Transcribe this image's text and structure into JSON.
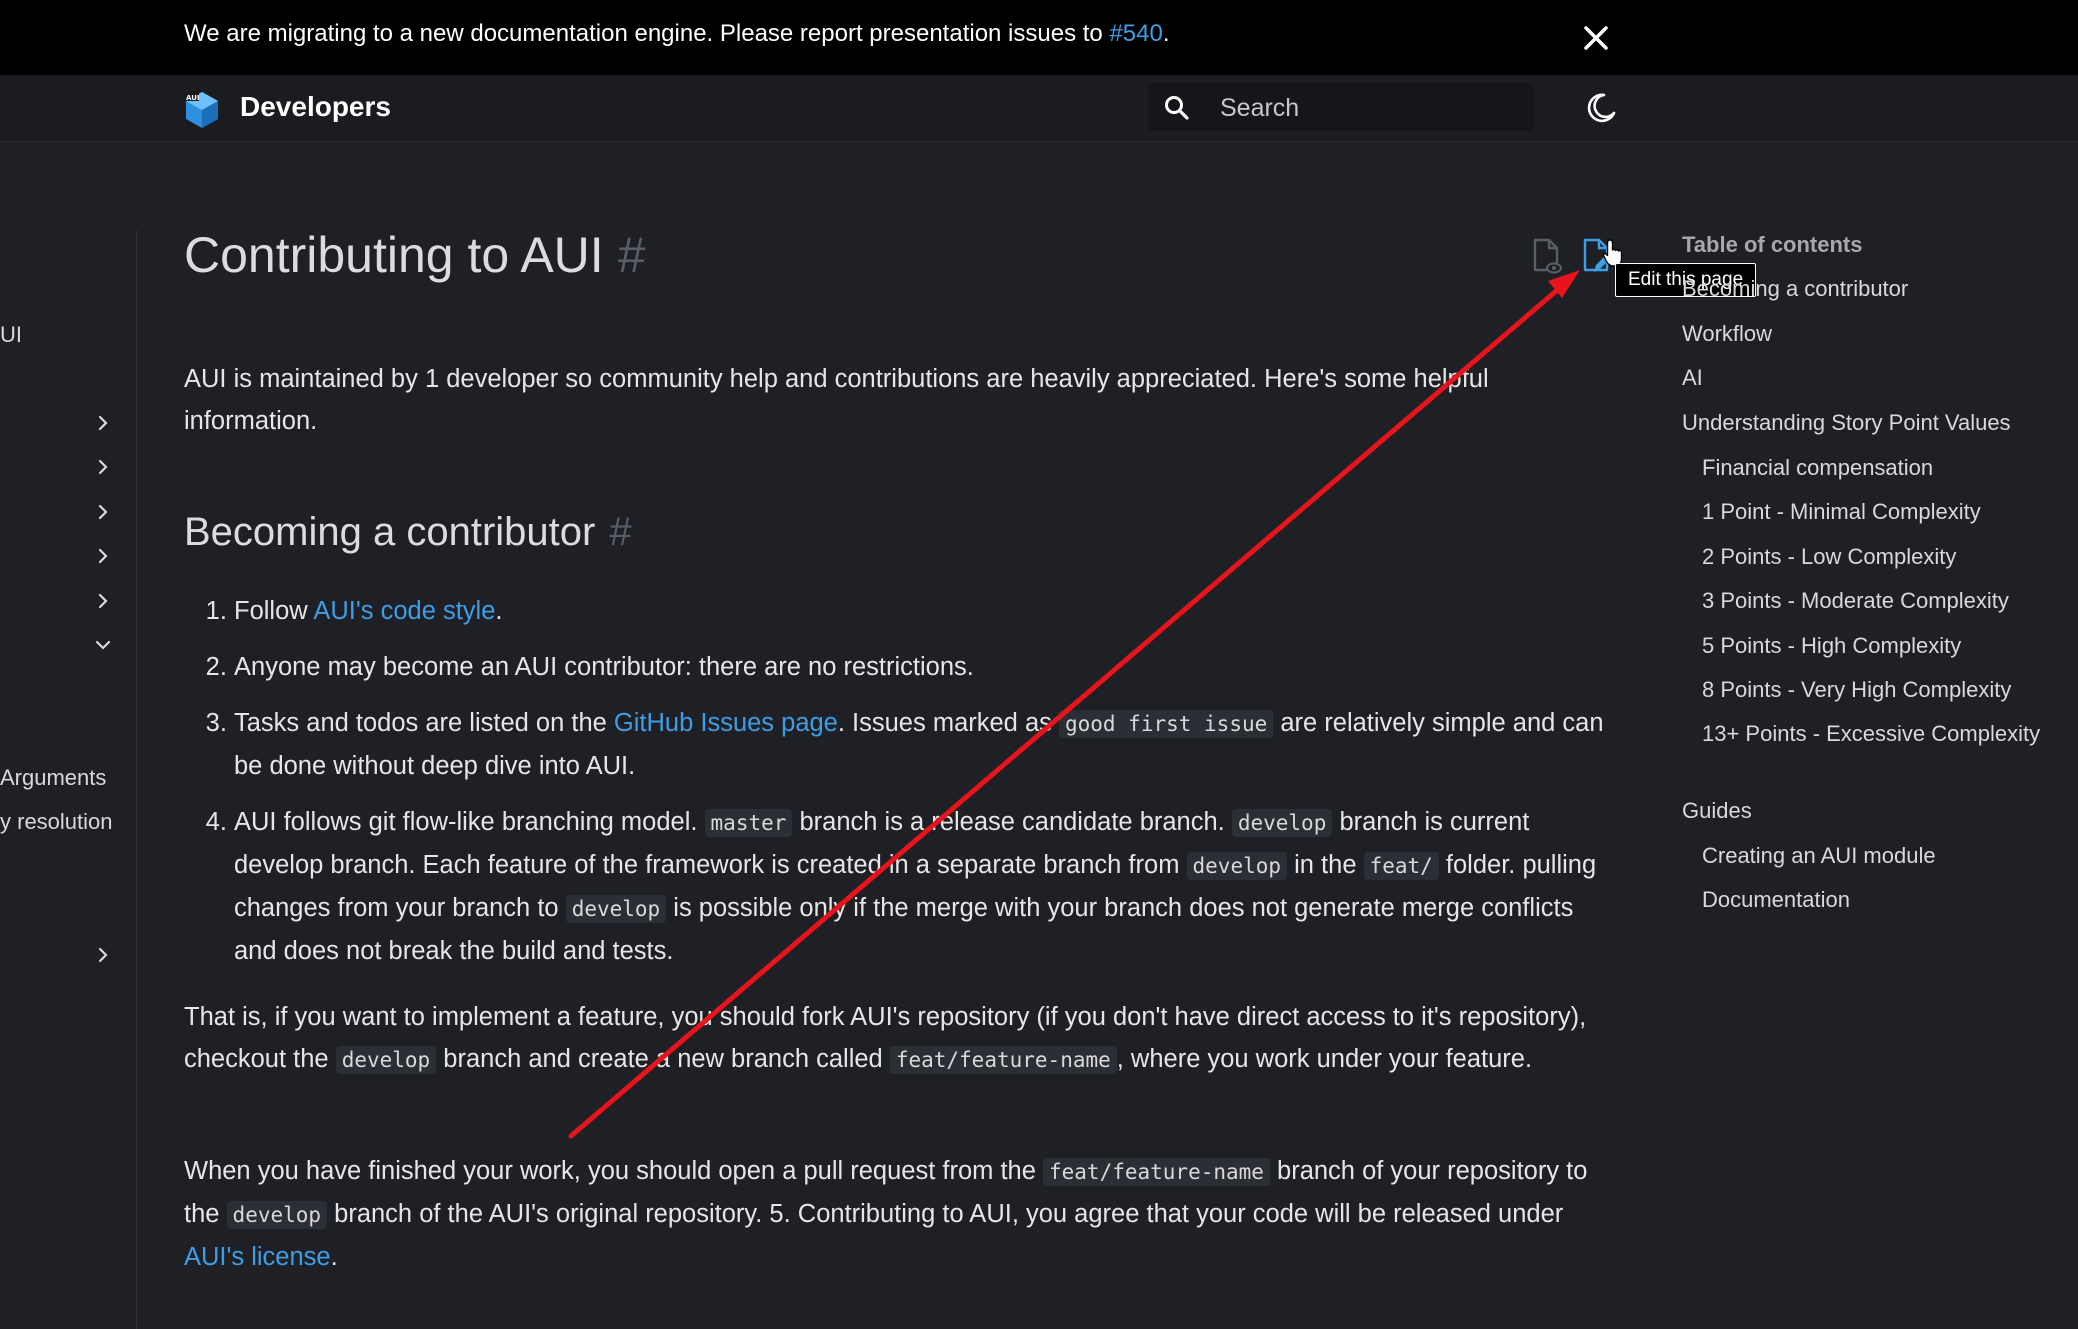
{
  "banner": {
    "text": "We are migrating to a new documentation engine. Please report presentation issues to ",
    "link": "#540",
    "text_end": "."
  },
  "header": {
    "brand": "Developers",
    "search_placeholder": "Search"
  },
  "sidebar": {
    "fragments": [
      "UI",
      "Arguments",
      "y resolution"
    ]
  },
  "main": {
    "title": "Contributing to AUI",
    "hash": "#",
    "tooltip": "Edit this page",
    "intro": "AUI is maintained by 1 developer so community help and contributions are heavily appreciated. Here's some helpful information.",
    "section_title": "Becoming a contributor",
    "steps": {
      "s1_pre": "Follow ",
      "s1_link": "AUI's code style",
      "s1_post": ".",
      "s2": "Anyone may become an AUI contributor: there are no restrictions.",
      "s3_pre": "Tasks and todos are listed on the ",
      "s3_link": "GitHub Issues page",
      "s3_mid": ". Issues marked as ",
      "s3_code": "good first issue",
      "s3_post": " are relatively simple and can be done without deep dive into AUI.",
      "s4_a": "AUI follows git flow-like branching model. ",
      "s4_code_master": "master",
      "s4_b": " branch is a release candidate branch. ",
      "s4_code_develop1": "develop",
      "s4_c": " branch is current develop branch. Each feature of the framework is created in a separate branch from ",
      "s4_code_develop2": "develop",
      "s4_d": " in the ",
      "s4_code_feat": "feat/",
      "s4_e": " folder. pulling changes from your branch to ",
      "s4_code_develop3": "develop",
      "s4_f": " is possible only if the merge with your branch does not generate merge conflicts and does not break the build and tests."
    },
    "p2": {
      "a": "That is, if you want to implement a feature, you should fork AUI's repository (if you don't have direct access to it's repository), checkout the ",
      "code1": "develop",
      "b": " branch and create a new branch called ",
      "code2": "feat/feature-name",
      "c": ", where you work under your feature."
    },
    "p3": {
      "a": "When you have finished your work, you should open a pull request from the ",
      "code1": "feat/feature-name",
      "b": " branch of your repository to the ",
      "code2": "develop",
      "c": " branch of the AUI's original repository. 5. Contributing to AUI, you agree that your code will be released under ",
      "link": "AUI's license",
      "d": "."
    }
  },
  "toc": {
    "title": "Table of contents",
    "items": [
      {
        "label": "Becoming a contributor",
        "level": 1
      },
      {
        "label": "Workflow",
        "level": 1
      },
      {
        "label": "AI",
        "level": 1
      },
      {
        "label": "Understanding Story Point Values",
        "level": 1
      },
      {
        "label": "Financial compensation",
        "level": 2
      },
      {
        "label": "1 Point - Minimal Complexity",
        "level": 2
      },
      {
        "label": "2 Points - Low Complexity",
        "level": 2
      },
      {
        "label": "3 Points - Moderate Complexity",
        "level": 2
      },
      {
        "label": "5 Points - High Complexity",
        "level": 2
      },
      {
        "label": "8 Points - Very High Complexity",
        "level": 2
      },
      {
        "label": "13+ Points - Excessive Complexity",
        "level": 2
      },
      {
        "label": "Guides",
        "level": 1
      },
      {
        "label": "Creating an AUI module",
        "level": 2
      },
      {
        "label": "Documentation",
        "level": 2
      }
    ]
  },
  "colors": {
    "background": "#1f2025",
    "banner": "#000000",
    "link": "#3d9ee6",
    "annotation_arrow": "#e8141b"
  }
}
